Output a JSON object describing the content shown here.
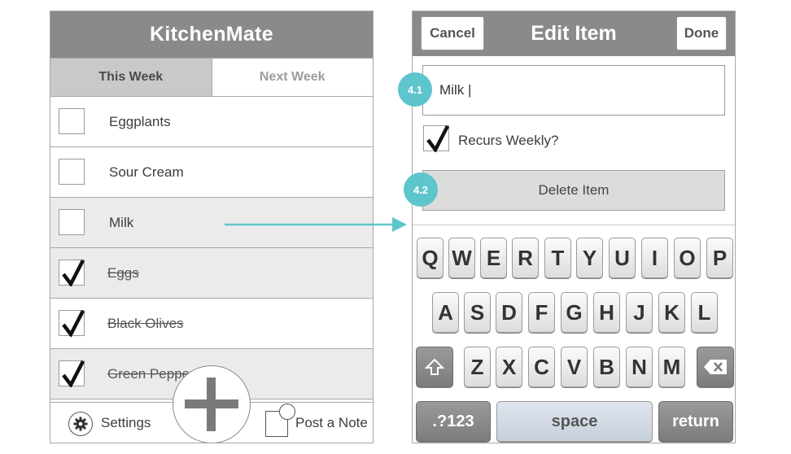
{
  "list_screen": {
    "app_title": "KitchenMate",
    "tabs": [
      {
        "label": "This Week",
        "active": true
      },
      {
        "label": "Next Week",
        "active": false
      }
    ],
    "items": [
      {
        "label": "Eggplants",
        "checked": false
      },
      {
        "label": "Sour Cream",
        "checked": false
      },
      {
        "label": "Milk",
        "checked": false
      },
      {
        "label": "Eggs",
        "checked": true
      },
      {
        "label": "Black Olives",
        "checked": true
      },
      {
        "label": "Green Pepper",
        "checked": true
      }
    ],
    "footer": {
      "settings_label": "Settings",
      "post_note_label": "Post a Note",
      "settings_icon": "gear-icon",
      "post_note_icon": "note-icon",
      "add_icon": "plus-icon"
    }
  },
  "edit_screen": {
    "title": "Edit Item",
    "cancel_label": "Cancel",
    "done_label": "Done",
    "item_value": "Milk |",
    "recurs_label": "Recurs Weekly?",
    "recurs_checked": true,
    "delete_label": "Delete Item",
    "annotations": [
      "4.1",
      "4.2"
    ]
  },
  "keyboard": {
    "row1": [
      "Q",
      "W",
      "E",
      "R",
      "T",
      "Y",
      "U",
      "I",
      "O",
      "P"
    ],
    "row2": [
      "A",
      "S",
      "D",
      "F",
      "G",
      "H",
      "J",
      "K",
      "L"
    ],
    "row3": [
      "Z",
      "X",
      "C",
      "V",
      "B",
      "N",
      "M"
    ],
    "shift_icon": "shift-icon",
    "delete_icon": "backspace-icon",
    "numbers_label": ".?123",
    "space_label": "space",
    "return_label": "return"
  },
  "colors": {
    "header": "#8a8a8a",
    "accent": "#5ec5cc",
    "shaded_row": "#ebebeb",
    "active_tab": "#c9c9c9"
  }
}
